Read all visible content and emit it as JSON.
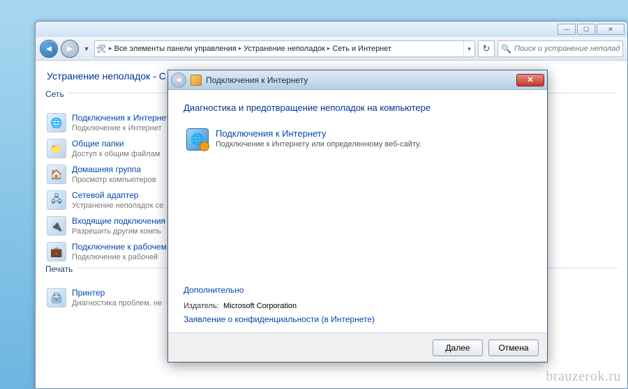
{
  "explorer": {
    "breadcrumb": {
      "root": "Все элементы панели управления",
      "level1": "Устранение неполадок",
      "level2": "Сеть и Интернет"
    },
    "search_placeholder": "Поиск и устранение неполадок",
    "page_title": "Устранение неполадок - С",
    "sections": [
      {
        "header": "Сеть",
        "items": [
          {
            "title": "Подключения к Интернет",
            "subtitle": "Подключение к Интернет",
            "icon": "🌐"
          },
          {
            "title": "Общие папки",
            "subtitle": "Доступ к общим файлам",
            "icon": "📁"
          },
          {
            "title": "Домашняя группа",
            "subtitle": "Просмотр компьютеров",
            "icon": "🏠"
          },
          {
            "title": "Сетевой адаптер",
            "subtitle": "Устранение неполадок се",
            "icon": "🖧"
          },
          {
            "title": "Входящие подключения",
            "subtitle": "Разрешить другим компь",
            "icon": "🔌"
          },
          {
            "title": "Подключение к рабочем",
            "subtitle": "Подключение к рабочей",
            "icon": "💼"
          }
        ]
      },
      {
        "header": "Печать",
        "items": [
          {
            "title": "Принтер",
            "subtitle": "Диагностика проблем, не",
            "icon": "🖨"
          }
        ]
      }
    ]
  },
  "wizard": {
    "titlebar": "Подключения к Интернету",
    "heading": "Диагностика и предотвращение неполадок на компьютере",
    "option_title": "Подключения к Интернету",
    "option_sub": "Подключение к Интернету или определенному веб-сайту.",
    "advanced": "Дополнительно",
    "publisher_label": "Издатель:",
    "publisher_value": "Microsoft Corporation",
    "privacy": "Заявление о конфиденциальности (в Интернете)",
    "next": "Далее",
    "cancel": "Отмена"
  },
  "watermark": "brauzerok.ru"
}
